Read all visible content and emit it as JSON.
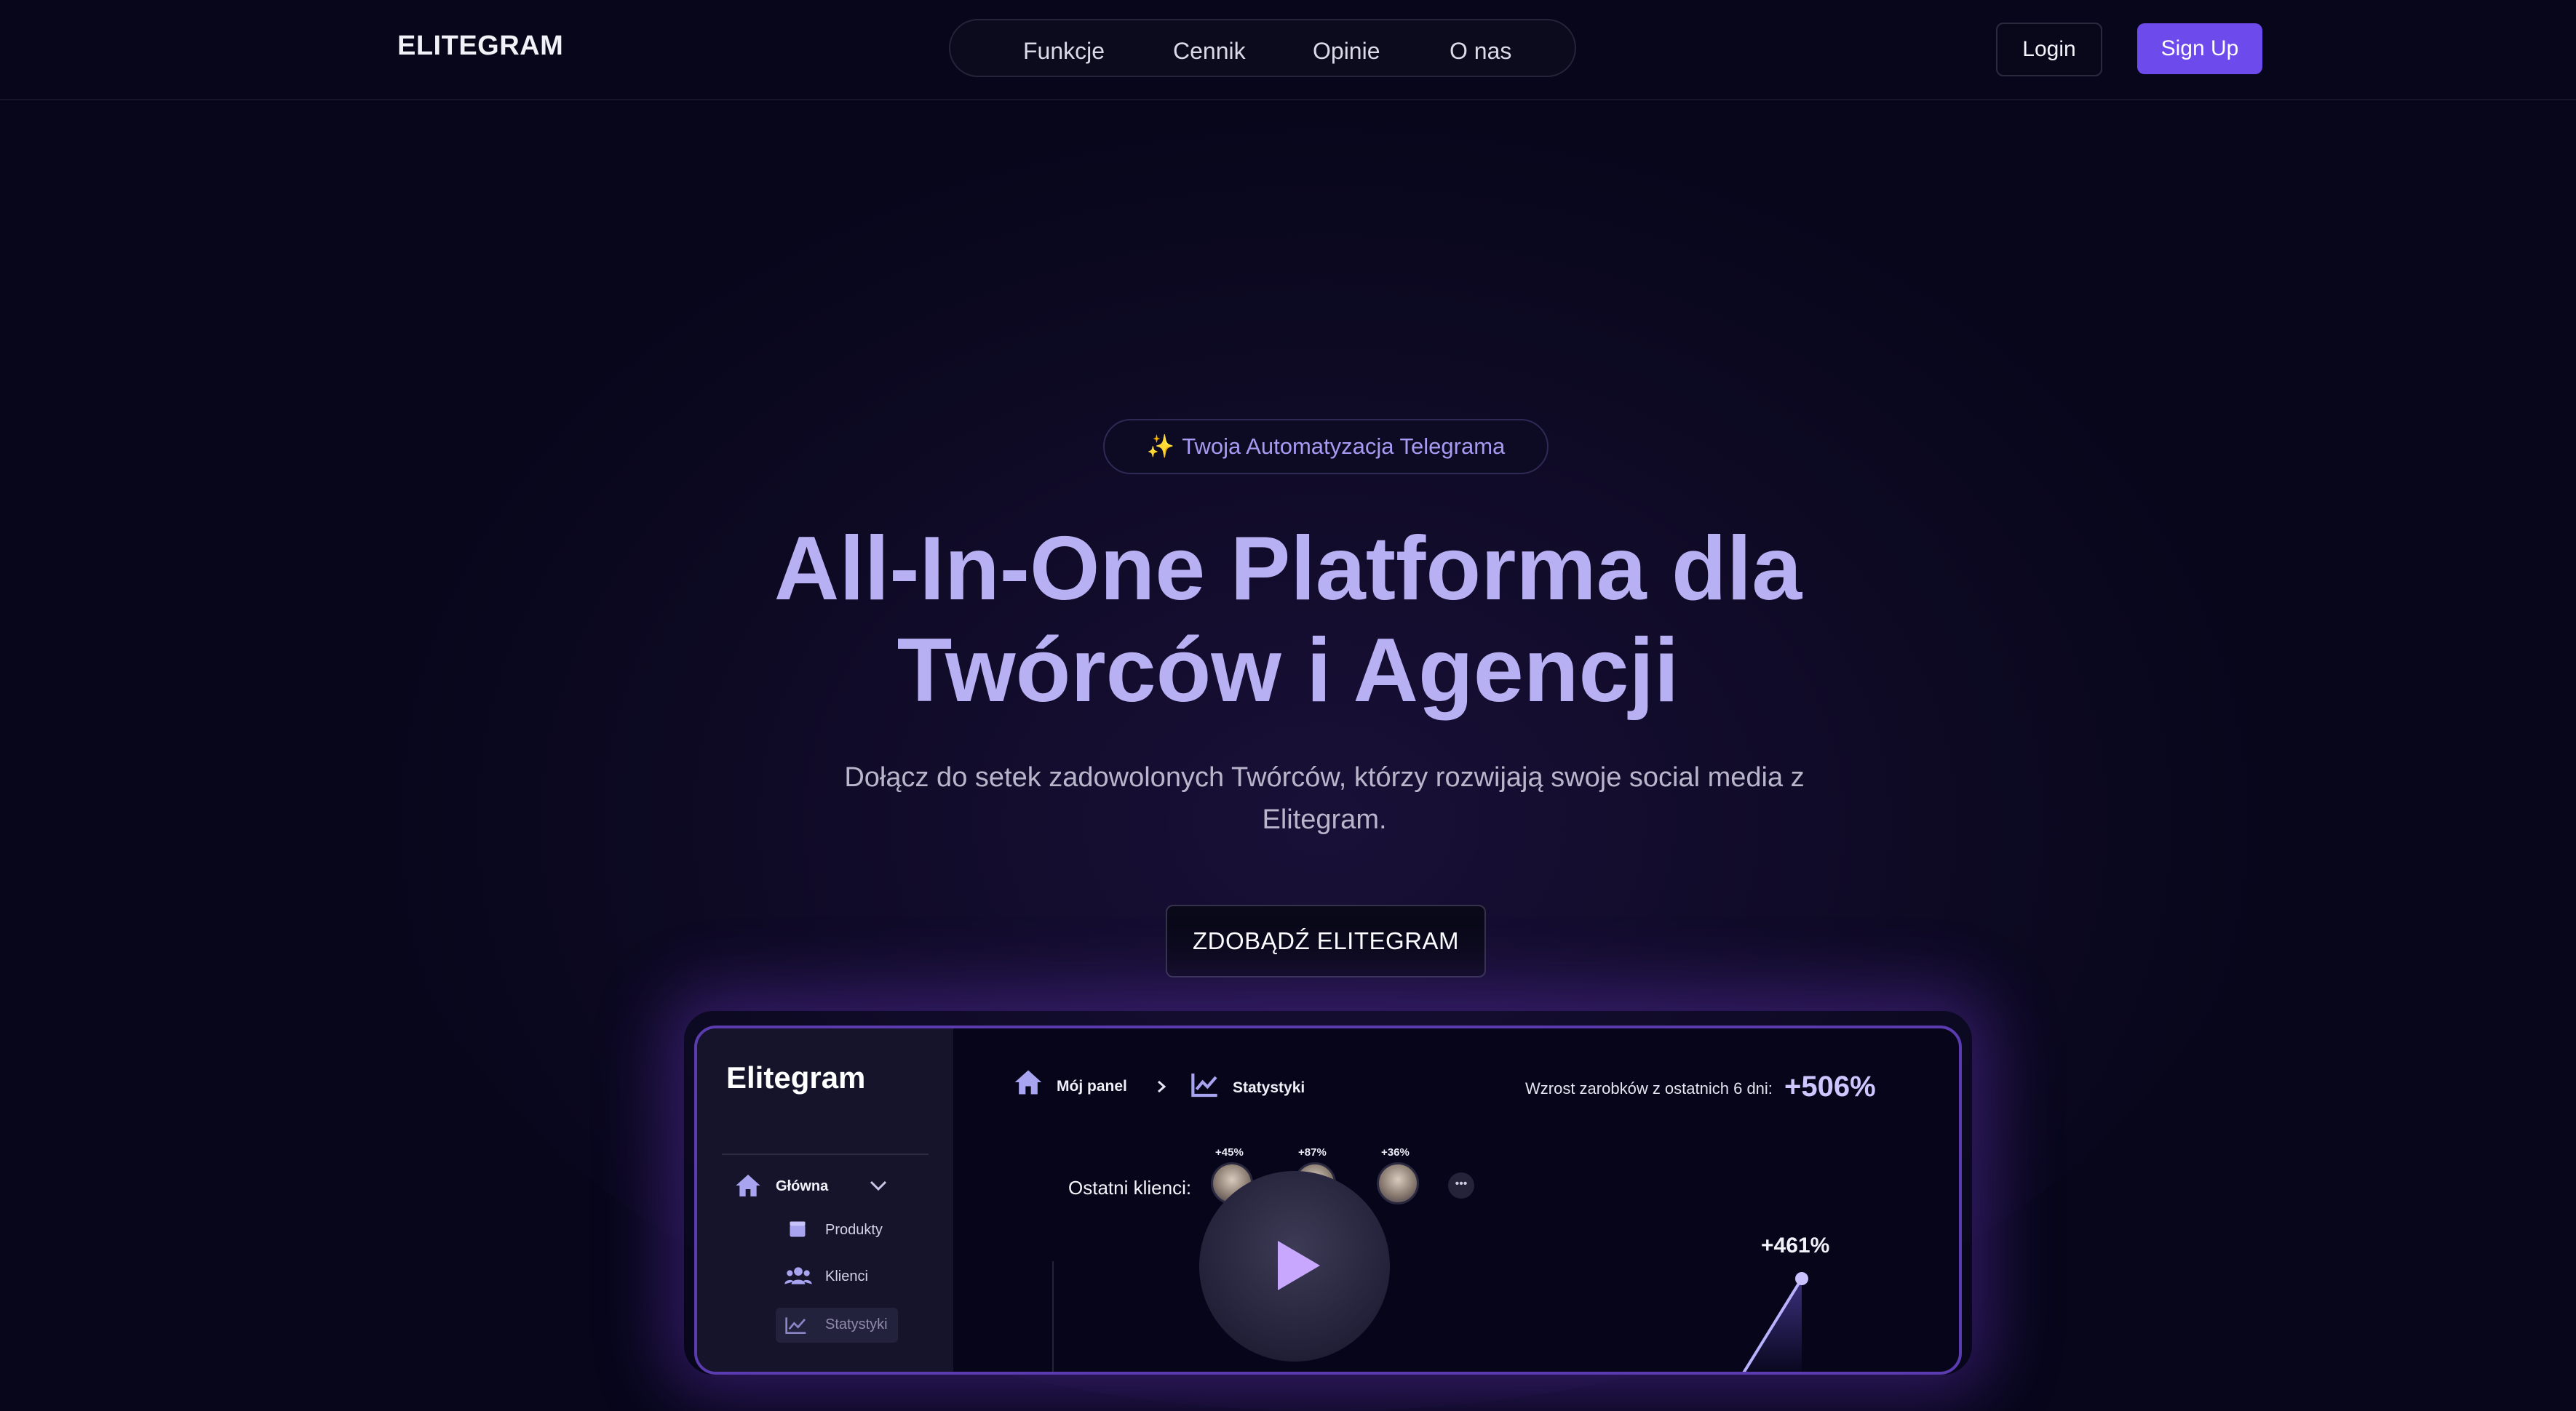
{
  "header": {
    "logo": "ELITEGRAM",
    "nav": [
      {
        "label": "Funkcje"
      },
      {
        "label": "Cennik"
      },
      {
        "label": "Opinie"
      },
      {
        "label": "O nas"
      }
    ],
    "login_label": "Login",
    "signup_label": "Sign Up"
  },
  "hero": {
    "badge_icon": "sparkles-icon",
    "badge_emoji": "✨",
    "badge_text": "Twoja Automatyzacja Telegrama",
    "title_line1": "All-In-One Platforma dla",
    "title_line2": "Twórców i Agencji",
    "subtitle_line1": "Dołącz do setek zadowolonych Twórców, którzy rozwijają swoje social media z",
    "subtitle_line2": "Elitegram.",
    "cta_label": "ZDOBĄDŹ ELITEGRAM"
  },
  "dashboard": {
    "brand": "Elitegram",
    "sidebar": {
      "section": "Główna",
      "items": [
        {
          "label": "Produkty",
          "icon": "box-icon"
        },
        {
          "label": "Klienci",
          "icon": "users-icon"
        },
        {
          "label": "Statystyki",
          "icon": "chart-icon"
        }
      ]
    },
    "breadcrumb": [
      "Mój panel",
      "Statystyki"
    ],
    "growth_label": "Wzrost zarobków z ostatnich 6 dni:",
    "growth_value": "+506%",
    "clients_label": "Ostatni klienci:",
    "clients": [
      {
        "pct": "+45%"
      },
      {
        "pct": "+87%"
      },
      {
        "pct": "+36%"
      }
    ],
    "more_label": "•••",
    "chart_peak_label": "+461%"
  },
  "colors": {
    "background": "#07061a",
    "accent": "#6d4aec",
    "title": "#b7b1f4"
  }
}
